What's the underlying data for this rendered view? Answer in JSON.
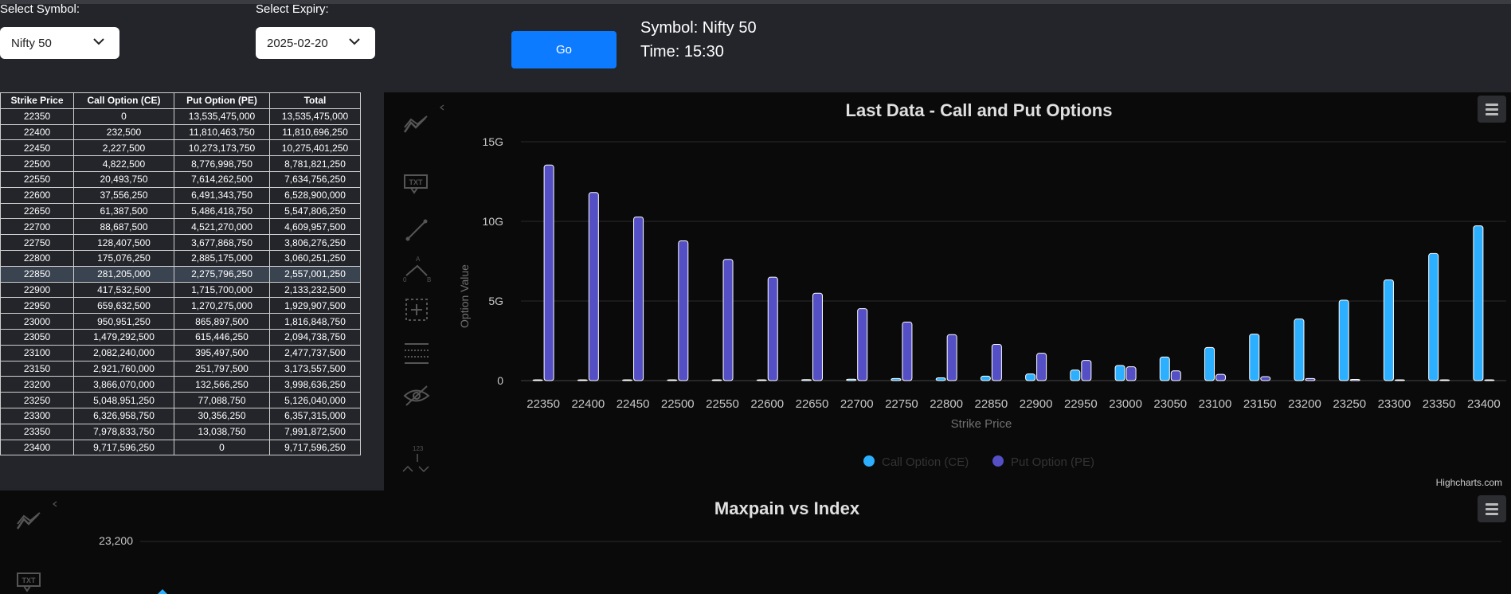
{
  "controls": {
    "symbol_label": "Select Symbol:",
    "symbol_value": "Nifty 50",
    "expiry_label": "Select Expiry:",
    "expiry_value": "2025-02-20",
    "go_label": "Go"
  },
  "info": {
    "symbol": "Symbol: Nifty 50",
    "time": "Time: 15:30"
  },
  "table": {
    "headers": [
      "Strike Price",
      "Call Option (CE)",
      "Put Option (PE)",
      "Total"
    ],
    "highlight_row": 10,
    "rows": [
      [
        "22350",
        "0",
        "13,535,475,000",
        "13,535,475,000"
      ],
      [
        "22400",
        "232,500",
        "11,810,463,750",
        "11,810,696,250"
      ],
      [
        "22450",
        "2,227,500",
        "10,273,173,750",
        "10,275,401,250"
      ],
      [
        "22500",
        "4,822,500",
        "8,776,998,750",
        "8,781,821,250"
      ],
      [
        "22550",
        "20,493,750",
        "7,614,262,500",
        "7,634,756,250"
      ],
      [
        "22600",
        "37,556,250",
        "6,491,343,750",
        "6,528,900,000"
      ],
      [
        "22650",
        "61,387,500",
        "5,486,418,750",
        "5,547,806,250"
      ],
      [
        "22700",
        "88,687,500",
        "4,521,270,000",
        "4,609,957,500"
      ],
      [
        "22750",
        "128,407,500",
        "3,677,868,750",
        "3,806,276,250"
      ],
      [
        "22800",
        "175,076,250",
        "2,885,175,000",
        "3,060,251,250"
      ],
      [
        "22850",
        "281,205,000",
        "2,275,796,250",
        "2,557,001,250"
      ],
      [
        "22900",
        "417,532,500",
        "1,715,700,000",
        "2,133,232,500"
      ],
      [
        "22950",
        "659,632,500",
        "1,270,275,000",
        "1,929,907,500"
      ],
      [
        "23000",
        "950,951,250",
        "865,897,500",
        "1,816,848,750"
      ],
      [
        "23050",
        "1,479,292,500",
        "615,446,250",
        "2,094,738,750"
      ],
      [
        "23100",
        "2,082,240,000",
        "395,497,500",
        "2,477,737,500"
      ],
      [
        "23150",
        "2,921,760,000",
        "251,797,500",
        "3,173,557,500"
      ],
      [
        "23200",
        "3,866,070,000",
        "132,566,250",
        "3,998,636,250"
      ],
      [
        "23250",
        "5,048,951,250",
        "77,088,750",
        "5,126,040,000"
      ],
      [
        "23300",
        "6,326,958,750",
        "30,356,250",
        "6,357,315,000"
      ],
      [
        "23350",
        "7,978,833,750",
        "13,038,750",
        "7,991,872,500"
      ],
      [
        "23400",
        "9,717,596,250",
        "0",
        "9,717,596,250"
      ]
    ]
  },
  "chart_data": [
    {
      "type": "bar",
      "title": "Last Data - Call and Put Options",
      "xlabel": "Strike Price",
      "ylabel": "Option Value",
      "categories": [
        "22350",
        "22400",
        "22450",
        "22500",
        "22550",
        "22600",
        "22650",
        "22700",
        "22750",
        "22800",
        "22850",
        "22900",
        "22950",
        "23000",
        "23050",
        "23100",
        "23150",
        "23200",
        "23250",
        "23300",
        "23350",
        "23400"
      ],
      "ylim": [
        0,
        15000000000
      ],
      "yticks": [
        0,
        5000000000,
        10000000000,
        15000000000
      ],
      "ytick_labels": [
        "0",
        "5G",
        "10G",
        "15G"
      ],
      "grid": true,
      "legend": "bottom-center",
      "credits": "Highcharts.com",
      "series": [
        {
          "name": "Call Option (CE)",
          "color": "#2caffe",
          "values": [
            0,
            232500,
            2227500,
            4822500,
            20493750,
            37556250,
            61387500,
            88687500,
            128407500,
            175076250,
            281205000,
            417532500,
            659632500,
            950951250,
            1479292500,
            2082240000,
            2921760000,
            3866070000,
            5048951250,
            6326958750,
            7978833750,
            9717596250
          ]
        },
        {
          "name": "Put Option (PE)",
          "color": "#544fc5",
          "values": [
            13535475000,
            11810463750,
            10273173750,
            8776998750,
            7614262500,
            6491343750,
            5486418750,
            4521270000,
            3677868750,
            2885175000,
            2275796250,
            1715700000,
            1270275000,
            865897500,
            615446250,
            395497500,
            251797500,
            132566250,
            77088750,
            30356250,
            13038750,
            0
          ]
        }
      ]
    },
    {
      "type": "line",
      "title": "Maxpain vs Index",
      "ytick_labels": [
        "23,200"
      ]
    }
  ]
}
